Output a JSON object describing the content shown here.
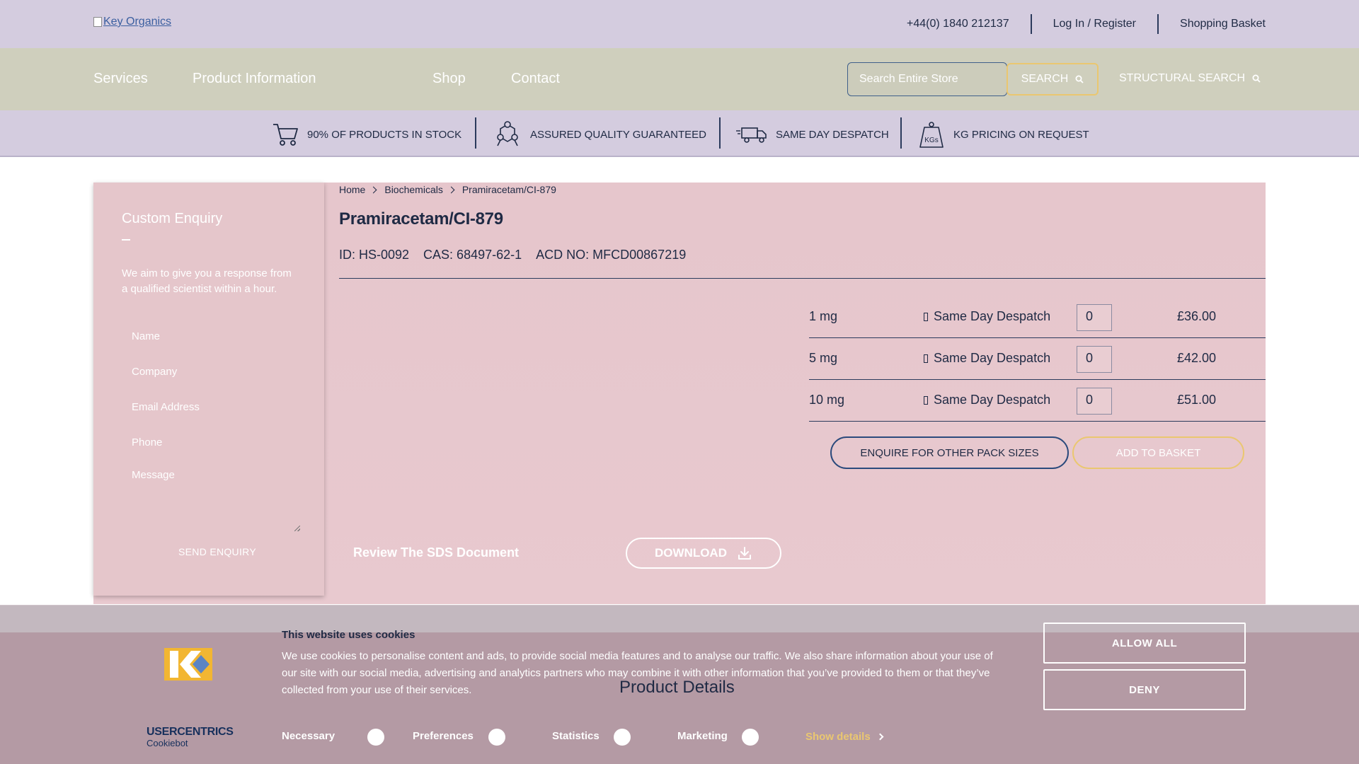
{
  "header": {
    "logo_alt": "Key Organics",
    "phone": "+44(0) 1840 212137",
    "login": "Log In / Register",
    "basket": "Shopping Basket"
  },
  "nav": {
    "items": [
      "Services",
      "Product Information",
      "Shop",
      "Contact"
    ],
    "search_placeholder": "Search Entire Store",
    "search_button": "SEARCH",
    "structural_search": "STRUCTURAL SEARCH"
  },
  "usp": [
    {
      "label": "90% OF PRODUCTS IN STOCK",
      "icon": "cart-icon"
    },
    {
      "label": "ASSURED QUALITY GUARANTEED",
      "icon": "molecule-icon"
    },
    {
      "label": "SAME DAY DESPATCH",
      "icon": "truck-icon"
    },
    {
      "label": "KG PRICING ON REQUEST",
      "icon": "kg-weight-icon"
    }
  ],
  "enquiry": {
    "title": "Custom Enquiry",
    "description": "We aim to give you a response from a qualified scientist within a hour.",
    "fields": {
      "name": "Name",
      "company": "Company",
      "email": "Email Address",
      "phone": "Phone",
      "message": "Message"
    },
    "send": "SEND ENQUIRY"
  },
  "breadcrumb": [
    "Home",
    "Biochemicals",
    "Pramiracetam/CI-879"
  ],
  "product": {
    "title": "Pramiracetam/CI-879",
    "id": "ID: HS-0092",
    "cas": "CAS: 68497-62-1",
    "acd": "ACD NO: MFCD00867219",
    "packs": [
      {
        "size": "1 mg",
        "despatch": "Same Day Despatch",
        "qty": "0",
        "price": "£36.00"
      },
      {
        "size": "5 mg",
        "despatch": "Same Day Despatch",
        "qty": "0",
        "price": "£42.00"
      },
      {
        "size": "10 mg",
        "despatch": "Same Day Despatch",
        "qty": "0",
        "price": "£51.00"
      }
    ],
    "enquire_button": "ENQUIRE FOR OTHER PACK SIZES",
    "basket_button": "ADD TO BASKET",
    "sds_label": "Review The SDS Document",
    "download_button": "DOWNLOAD"
  },
  "cookie": {
    "title": "This website uses cookies",
    "text": "We use cookies to personalise content and ads, to provide social media features and to analyse our traffic. We also share information about your use of our site with our social media, advertising and analytics partners who may combine it with other information that you’ve provided to them or that they’ve collected from your use of their services.",
    "behind_heading": "Product Details",
    "options": [
      "Necessary",
      "Preferences",
      "Statistics",
      "Marketing"
    ],
    "show_details": "Show details",
    "allow_all": "ALLOW ALL",
    "deny": "DENY",
    "brand_name": "USERCENTRICS",
    "brand_sub": "Cookiebot"
  },
  "colors": {
    "top_bar": "#d4ccdf",
    "nav_bar": "#cfcfbd",
    "main_panel": "#e6c6cc",
    "accent_gold": "#eac770",
    "navy": "#1f2a44",
    "cookie_bg": "#b49aa4"
  }
}
